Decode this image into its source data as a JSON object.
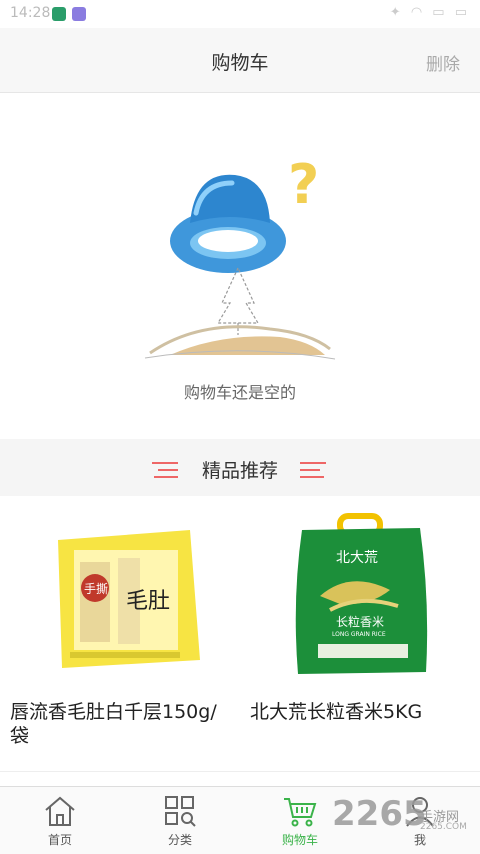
{
  "status_bar": {
    "time": "14:28"
  },
  "header": {
    "title": "购物车",
    "delete_label": "删除"
  },
  "empty_cart": {
    "message": "购物车还是空的"
  },
  "recommend": {
    "title": "精品推荐"
  },
  "products": [
    {
      "name": "唇流香毛肚白千层150g/袋",
      "package_text_1": "手撕",
      "package_text_2": "毛肚"
    },
    {
      "name": "北大荒长粒香米5KG",
      "package_brand": "北大荒",
      "package_text": "长粒香米",
      "package_en": "LONG GRAIN RICE"
    }
  ],
  "tabbar": {
    "tabs": [
      {
        "label": "首页",
        "icon": "home-icon"
      },
      {
        "label": "分类",
        "icon": "category-icon"
      },
      {
        "label": "购物车",
        "icon": "cart-icon",
        "active": true
      },
      {
        "label": "我",
        "icon": "profile-icon"
      }
    ]
  },
  "watermark": {
    "number": "2265",
    "cn": "手游网",
    "url": "2265.COM"
  },
  "colors": {
    "accent": "#3bb34a",
    "recommend_lines": "#e66",
    "hat": "#4a9fe0"
  }
}
